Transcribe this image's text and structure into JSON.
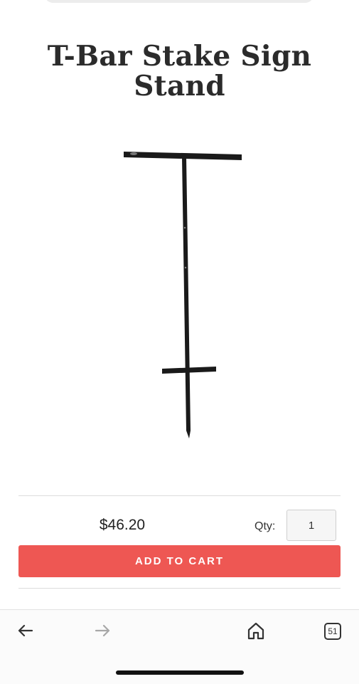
{
  "product": {
    "title_line1": "T-Bar Stake Sign",
    "title_line2": "Stand",
    "price": "$46.20",
    "qty_label": "Qty:",
    "qty_value": "1",
    "add_to_cart_label": "ADD TO CART"
  },
  "browser": {
    "tabs_count": "51",
    "icons": [
      "back-arrow-icon",
      "forward-arrow-icon",
      "home-icon",
      "tabs-icon"
    ]
  },
  "colors": {
    "accent": "#ee5753",
    "text": "#2b2b2b"
  }
}
